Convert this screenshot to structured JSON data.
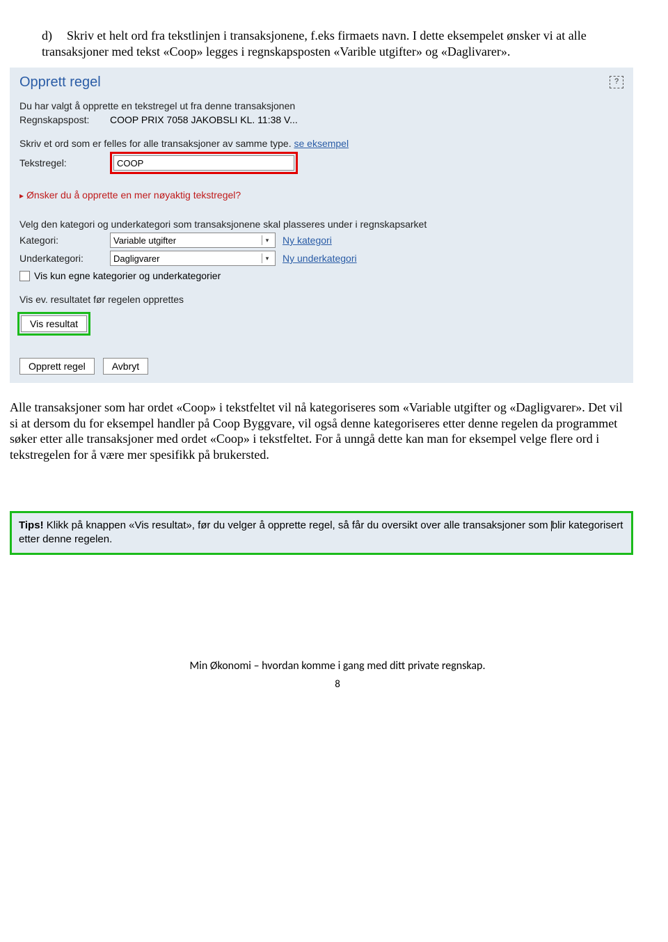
{
  "intro": {
    "marker": "d)",
    "text": "Skriv et helt ord fra tekstlinjen i transaksjonene, f.eks firmaets navn. I dette eksempelet ønsker vi at alle transaksjoner med tekst «Coop» legges i regnskapsposten «Varible utgifter» og «Daglivarer»."
  },
  "app": {
    "title": "Opprett regel",
    "help": "?",
    "line1": "Du har valgt å opprette en tekstregel ut fra denne transaksjonen",
    "rp_label": "Regnskapspost:",
    "rp_value": "COOP PRIX 7058 JAKOBSLI KL. 11:38 V...",
    "instr": "Skriv et ord som er felles for alle transaksjoner av samme type.",
    "se_eks": "se eksempel",
    "tr_label": "Tekstregel:",
    "tr_value": "COOP",
    "expand": "Ønsker du å opprette en mer nøyaktig tekstregel?",
    "cat_instr": "Velg den kategori og underkategori som transaksjonene skal plasseres under i regnskapsarket",
    "kat_label": "Kategori:",
    "kat_value": "Variable utgifter",
    "ny_kat": "Ny kategori",
    "uk_label": "Underkategori:",
    "uk_value": "Dagligvarer",
    "ny_uk": "Ny underkategori",
    "chk_label": "Vis kun egne kategorier og underkategorier",
    "vis_line": "Vis ev. resultatet før regelen opprettes",
    "vis_btn": "Vis resultat",
    "opprett_btn": "Opprett regel",
    "avbryt_btn": "Avbryt"
  },
  "body": {
    "p1": "Alle transaksjoner som har ordet «Coop» i tekstfeltet vil nå kategoriseres som «Variable utgifter og «Dagligvarer». Det vil si at dersom du for eksempel handler på Coop Byggvare, vil også denne kategoriseres etter denne regelen da programmet søker etter alle transaksjoner med ordet «Coop» i tekstfeltet. For å unngå dette kan man for eksempel velge flere ord i tekstregelen for å være mer spesifikk på brukersted."
  },
  "tips": {
    "label": "Tips!",
    "text_a": " Klikk på knappen «Vis resultat», før du velger å opprette regel, så får du oversikt over alle transaksjoner som ",
    "text_b": "blir kategorisert etter denne regelen."
  },
  "footer": "Min Økonomi – hvordan komme i gang med ditt private regnskap.",
  "page": "8"
}
